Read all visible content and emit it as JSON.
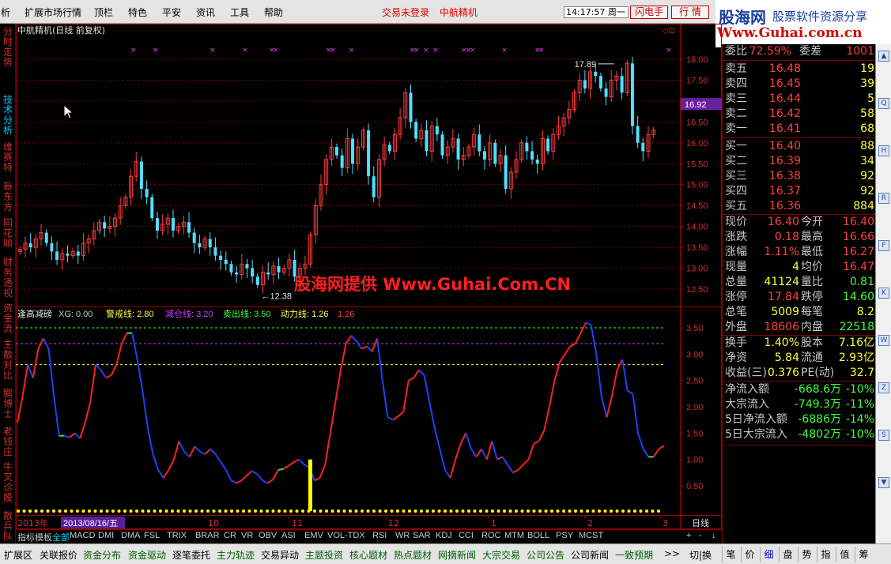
{
  "menu": {
    "items": [
      "析",
      "扩展市场行情",
      "顶栏",
      "特色",
      "平安",
      "资讯",
      "工具",
      "帮助"
    ],
    "login_status": "交易未登录",
    "stock_link": "中航精机",
    "clock": "14:17:57 周一",
    "flash_button": "闪电手",
    "quote_button": "行  情"
  },
  "banner": {
    "title": "股海网",
    "subtitle": "股票软件资源分享",
    "url": "Www.Guhai.com.cn"
  },
  "left_tabs": [
    {
      "label": "分时走势",
      "active": false
    },
    {
      "label": "技术分析",
      "active": true
    },
    {
      "label": "维赛特",
      "active": false
    },
    {
      "label": "新东方",
      "active": false
    },
    {
      "label": "同花顺",
      "active": false
    },
    {
      "label": "财务透视",
      "active": false
    },
    {
      "label": "资金流",
      "active": false
    },
    {
      "label": "主散对比",
      "active": false
    },
    {
      "label": "鹏博士",
      "active": false
    },
    {
      "label": "老钱庄",
      "active": false
    },
    {
      "label": "牛叉诊股",
      "active": false
    },
    {
      "label": "散兵队",
      "active": false
    }
  ],
  "chart_data": [
    {
      "type": "candlestick",
      "title": "中航精机(日线 前复权)",
      "ylim": [
        12.3,
        18.3
      ],
      "yticks": [
        "18.00",
        "17.50",
        "17.00",
        "16.50",
        "16.00",
        "15.50",
        "15.00",
        "14.50",
        "14.00",
        "13.50",
        "13.00",
        "12.50"
      ],
      "current_price": "16.92",
      "annotations": {
        "high": "17.89",
        "low": "12.38"
      },
      "grid": true
    },
    {
      "type": "line",
      "title": "逢高减磅",
      "legend": [
        {
          "label": "XG: 0.00",
          "color": "#c8c8c8"
        },
        {
          "label": "警戒线: 2.80",
          "color": "#ffff40"
        },
        {
          "label": "减仓线: 3.20",
          "color": "#d040ff"
        },
        {
          "label": "卖出线: 3.50",
          "color": "#40ff40"
        },
        {
          "label": "动力线: 1.26",
          "color": "#ffff40"
        },
        {
          "label": "1.26",
          "color": "#ff4040"
        }
      ],
      "ylim": [
        0,
        3.8
      ],
      "yticks": [
        "3.50",
        "3.00",
        "2.50",
        "2.00",
        "1.50",
        "1.00",
        "0.50"
      ],
      "reference_lines": [
        {
          "value": 3.5,
          "color": "#40ff40"
        },
        {
          "value": 3.2,
          "color": "#d040ff"
        },
        {
          "value": 2.8,
          "color": "#ffff40"
        }
      ],
      "series": [
        {
          "values": [
            1.7,
            2.2,
            2.8,
            2.55,
            3.1,
            3.3,
            3.1,
            2.2,
            1.45,
            1.45,
            1.42,
            1.5,
            1.4,
            1.7,
            2.1,
            2.8,
            2.7,
            2.55,
            2.6,
            2.8,
            3.2,
            3.4,
            3.4,
            2.9,
            2.3,
            1.6,
            1.1,
            0.8,
            0.65,
            0.8,
            1.0,
            1.35,
            1.15,
            1.05,
            1.25,
            1.15,
            1.1,
            1.2,
            1.1,
            0.95,
            0.8,
            0.6,
            0.55,
            0.6,
            0.7,
            0.78,
            0.72,
            0.6,
            0.55,
            0.62,
            0.8,
            0.82,
            0.88,
            0.95,
            1.0,
            0.9,
            0.85,
            0.6,
            0.65,
            0.9,
            1.5,
            2.1,
            2.7,
            3.2,
            3.35,
            3.25,
            3.1,
            3.15,
            3.05,
            3.3,
            2.5,
            1.8,
            1.75,
            1.82,
            1.9,
            2.5,
            2.55,
            2.7,
            2.6,
            2.1,
            1.6,
            1.2,
            0.8,
            0.65,
            1.0,
            1.3,
            1.5,
            1.2,
            1.05,
            1.2,
            1.0,
            1.35,
            1.0,
            1.05,
            0.9,
            0.75,
            0.8,
            0.9,
            1.0,
            1.3,
            1.35,
            1.55,
            2.0,
            2.5,
            2.85,
            3.0,
            3.15,
            3.2,
            3.4,
            3.6,
            3.55,
            3.0,
            2.2,
            1.8,
            2.2,
            2.7,
            2.9,
            2.3,
            2.25,
            1.5,
            1.2,
            1.05,
            1.05,
            1.2,
            1.26
          ]
        }
      ]
    }
  ],
  "x_axis": {
    "year_label": "2013年",
    "cursor_date": "2013/08/16/五",
    "month_ticks": [
      "10",
      "11",
      "12",
      "1",
      "2",
      "3"
    ],
    "period": "日线"
  },
  "watermark": "股海网提供 Www.Guhai.Com.CN",
  "quote_panel": {
    "weibi_label": "委比",
    "weibi_value": "72.59%",
    "weicha_label": "委差",
    "weicha_value": "1001",
    "asks": [
      {
        "label": "卖五",
        "price": "16.48",
        "vol": "19"
      },
      {
        "label": "卖四",
        "price": "16.45",
        "vol": "39"
      },
      {
        "label": "卖三",
        "price": "16.44",
        "vol": "5"
      },
      {
        "label": "卖二",
        "price": "16.42",
        "vol": "58"
      },
      {
        "label": "卖一",
        "price": "16.41",
        "vol": "68"
      }
    ],
    "bids": [
      {
        "label": "买一",
        "price": "16.40",
        "vol": "88"
      },
      {
        "label": "买二",
        "price": "16.39",
        "vol": "34"
      },
      {
        "label": "买三",
        "price": "16.38",
        "vol": "92"
      },
      {
        "label": "买四",
        "price": "16.37",
        "vol": "92"
      },
      {
        "label": "买五",
        "price": "16.36",
        "vol": "884"
      }
    ],
    "stats": [
      {
        "l1": "现价",
        "v1": "16.40",
        "c1": "#ff4040",
        "l2": "今开",
        "v2": "16.40",
        "c2": "#ff4040"
      },
      {
        "l1": "涨跌",
        "v1": "0.18",
        "c1": "#ff4040",
        "l2": "最高",
        "v2": "16.66",
        "c2": "#ff4040"
      },
      {
        "l1": "涨幅",
        "v1": "1.11%",
        "c1": "#ff4040",
        "l2": "最低",
        "v2": "16.27",
        "c2": "#ff4040"
      },
      {
        "l1": "现量",
        "v1": "4",
        "c1": "#ffff40",
        "l2": "均价",
        "v2": "16.47",
        "c2": "#ff4040"
      },
      {
        "l1": "总量",
        "v1": "41124",
        "c1": "#ffff40",
        "l2": "量比",
        "v2": "0.81",
        "c2": "#40ff40"
      },
      {
        "l1": "涨停",
        "v1": "17.84",
        "c1": "#ff4040",
        "l2": "跌停",
        "v2": "14.60",
        "c2": "#40ff40"
      },
      {
        "l1": "总笔",
        "v1": "5009",
        "c1": "#ffff40",
        "l2": "每笔",
        "v2": "8.2",
        "c2": "#ffff40"
      },
      {
        "l1": "外盘",
        "v1": "18606",
        "c1": "#ff4040",
        "l2": "内盘",
        "v2": "22518",
        "c2": "#40ff40"
      }
    ],
    "fundamentals": [
      {
        "l1": "换手",
        "v1": "1.40%",
        "l2": "股本",
        "v2": "7.16亿"
      },
      {
        "l1": "净资",
        "v1": "5.84",
        "l2": "流通",
        "v2": "2.93亿"
      },
      {
        "l1": "收益(三)",
        "v1": "0.376",
        "l2": "PE(动)",
        "v2": "32.7"
      }
    ],
    "flows": [
      {
        "label": "净流入额",
        "value": "-668.6万",
        "pct": "-10%"
      },
      {
        "label": "大宗流入",
        "value": "-749.3万",
        "pct": "-11%"
      },
      {
        "label": "5日净流入额",
        "value": "-6886万",
        "pct": "-14%"
      },
      {
        "label": "5日大宗流入",
        "value": "-4802万",
        "pct": "-10%"
      }
    ]
  },
  "indicator_tabs": [
    "指标",
    "模板",
    "全部",
    "MACD",
    "DMI",
    "DMA",
    "FSL",
    "TRIX",
    "BRAR",
    "CR",
    "VR",
    "OBV",
    "ASI",
    "EMV",
    "VOL-TDX",
    "RSI",
    "WR",
    "SAR",
    "KDJ",
    "CCI",
    "ROC",
    "MTM",
    "BOLL",
    "PSY",
    "MCST"
  ],
  "bottom_tabs": [
    {
      "label": "扩展区",
      "style": ""
    },
    {
      "label": "关联报价",
      "style": ""
    },
    {
      "label": "资金分布",
      "style": "green"
    },
    {
      "label": "资金驱动",
      "style": "green"
    },
    {
      "label": "逐笔委托",
      "style": ""
    },
    {
      "label": "主力轨迹",
      "style": "green"
    },
    {
      "label": "交易异动",
      "style": ""
    },
    {
      "label": "主题投资",
      "style": "green"
    },
    {
      "label": "核心题材",
      "style": "green"
    },
    {
      "label": "热点题材",
      "style": "green"
    },
    {
      "label": "网摘新闻",
      "style": "green"
    },
    {
      "label": "大宗交易",
      "style": "green"
    },
    {
      "label": "公司公告",
      "style": "green"
    },
    {
      "label": "公司新闻",
      "style": ""
    },
    {
      "label": "一致预期",
      "style": "green"
    },
    {
      "label": ">>",
      "style": ""
    },
    {
      "label": "切|换",
      "style": ""
    }
  ],
  "right_bottom_tabs": [
    "笔",
    "价",
    "细",
    "盘",
    "势",
    "指",
    "值",
    "筹"
  ],
  "colors": {
    "up": "#ff3c3c",
    "down": "#50e0ff",
    "grid": "#a00000",
    "panel_border": "#800000"
  }
}
